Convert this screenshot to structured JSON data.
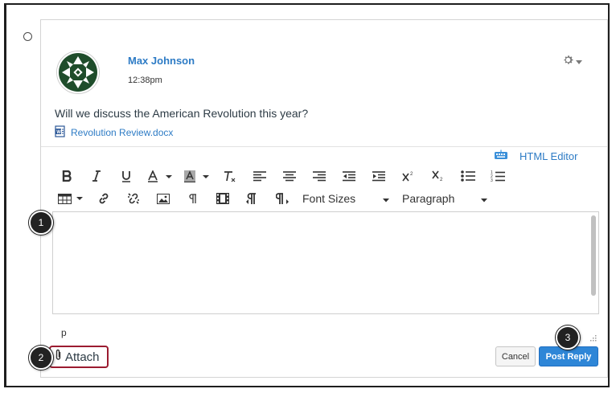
{
  "post": {
    "author": "Max Johnson",
    "time": "12:38pm",
    "message": "Will we discuss the American Revolution this year?",
    "attachment": "Revolution Review.docx"
  },
  "editor": {
    "html_editor_label": "HTML Editor",
    "font_sizes_label": "Font Sizes",
    "paragraph_label": "Paragraph",
    "path_label": "p"
  },
  "footer": {
    "attach_label": "Attach",
    "cancel_label": "Cancel",
    "post_reply_label": "Post Reply"
  },
  "callouts": {
    "one": "1",
    "two": "2",
    "three": "3"
  },
  "colors": {
    "link_blue": "#2d7bc5",
    "primary_button": "#2e86d7",
    "highlight_border": "#9b1b30"
  },
  "icons": [
    "gear-icon",
    "word-doc-icon",
    "keyboard-icon",
    "bold-icon",
    "italic-icon",
    "underline-icon",
    "font-color-icon",
    "background-color-icon",
    "clear-formatting-icon",
    "align-left-icon",
    "align-center-icon",
    "align-right-icon",
    "outdent-icon",
    "indent-icon",
    "superscript-icon",
    "subscript-icon",
    "bullet-list-icon",
    "numbered-list-icon",
    "table-icon",
    "link-icon",
    "unlink-icon",
    "image-icon",
    "paragraph-mark-icon",
    "media-icon",
    "ltr-icon",
    "rtl-icon",
    "paperclip-icon"
  ]
}
